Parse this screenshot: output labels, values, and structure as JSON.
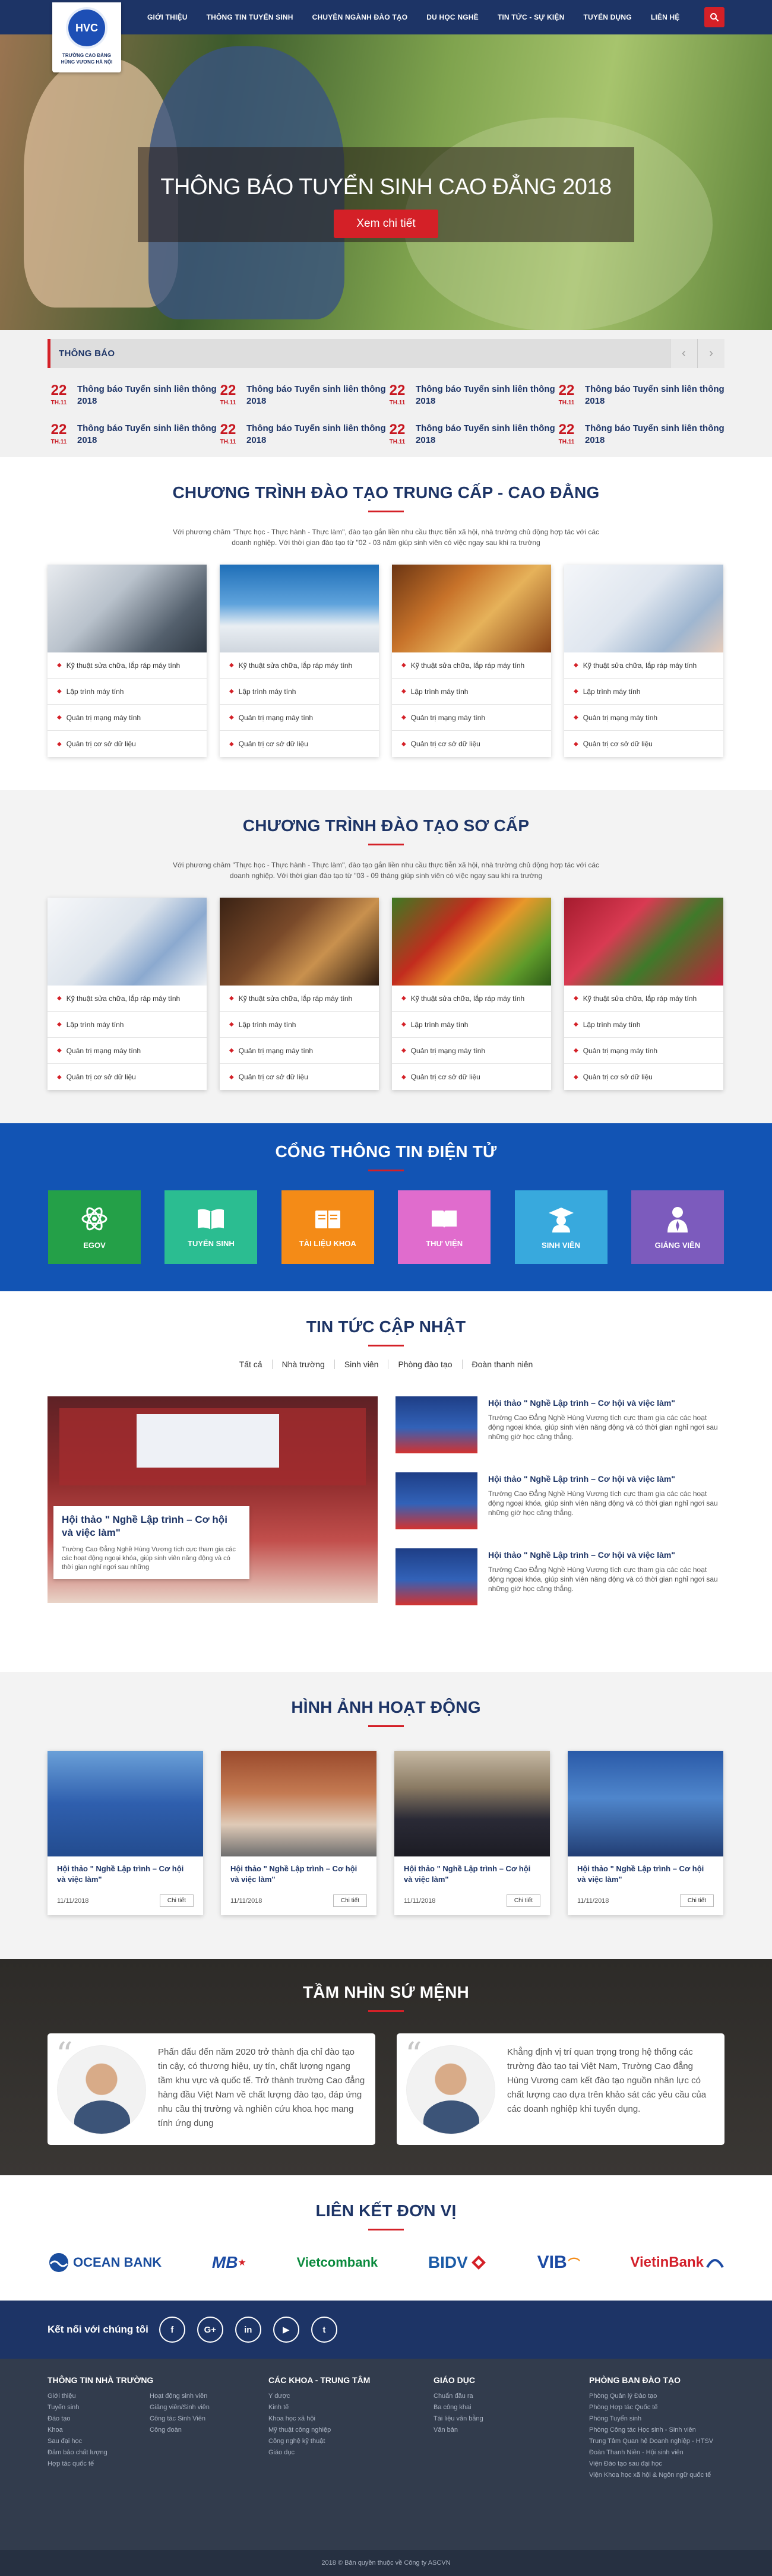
{
  "header": {
    "logo_text": "HVC",
    "logo_caption_1": "TRƯỜNG CAO ĐẲNG",
    "logo_caption_2": "HÙNG VƯƠNG HÀ NỘI",
    "nav": [
      "GIỚI THIỆU",
      "THÔNG TIN TUYỂN SINH",
      "CHUYÊN NGÀNH ĐÀO TẠO",
      "DU HỌC NGHỀ",
      "TIN TỨC - SỰ KIỆN",
      "TUYỂN DỤNG",
      "LIÊN HỆ"
    ]
  },
  "hero": {
    "title": "THÔNG BÁO TUYỂN SINH CAO ĐẲNG 2018",
    "button": "Xem chi tiết"
  },
  "announcements": {
    "title": "THÔNG BÁO",
    "items": [
      {
        "day": "22",
        "month": "TH.11",
        "text": "Thông báo Tuyển sinh liên thông 2018"
      },
      {
        "day": "22",
        "month": "TH.11",
        "text": "Thông báo Tuyển sinh liên thông 2018"
      },
      {
        "day": "22",
        "month": "TH.11",
        "text": "Thông báo Tuyển sinh liên thông 2018"
      },
      {
        "day": "22",
        "month": "TH.11",
        "text": "Thông báo Tuyển sinh liên thông 2018"
      },
      {
        "day": "22",
        "month": "TH.11",
        "text": "Thông báo Tuyển sinh liên thông 2018"
      },
      {
        "day": "22",
        "month": "TH.11",
        "text": "Thông báo Tuyển sinh liên thông 2018"
      },
      {
        "day": "22",
        "month": "TH.11",
        "text": "Thông báo Tuyển sinh liên thông 2018"
      },
      {
        "day": "22",
        "month": "TH.11",
        "text": "Thông báo Tuyển sinh liên thông 2018"
      }
    ]
  },
  "program_mid": {
    "title": "CHƯƠNG TRÌNH ĐÀO TẠO TRUNG CẤP - CAO ĐẲNG",
    "desc": "Với phương châm \"Thực học - Thực hành - Thực làm\", đào tạo gắn liền nhu cầu thực tiễn xã hội, nhà trường chủ động hợp tác với các doanh nghiệp. Với thời gian đào tạo từ \"02 - 03 năm giúp sinh viên có việc ngay sau khi ra trường",
    "items": [
      "Kỹ thuật sửa chữa, lắp ráp máy tính",
      "Lập trình máy tính",
      "Quản trị mạng máy tính",
      "Quản trị cơ sở dữ liệu"
    ]
  },
  "program_basic": {
    "title": "CHƯƠNG TRÌNH ĐÀO TẠO SƠ CẤP",
    "desc": "Với phương châm \"Thực học - Thực hành - Thực làm\", đào tạo gắn liền nhu cầu thực tiễn xã hội, nhà trường chủ động hợp tác với các doanh nghiệp. Với thời gian đào tạo từ \"03 - 09 tháng giúp sinh viên có việc ngay sau khi ra trường",
    "items": [
      "Kỹ thuật sửa chữa, lắp ráp máy tính",
      "Lập trình máy tính",
      "Quản trị mạng máy tính",
      "Quản trị cơ sở dữ liệu"
    ]
  },
  "portal": {
    "title": "CỔNG THÔNG TIN ĐIỆN TỬ",
    "tiles": [
      {
        "label": "EGOV",
        "color": "#24a048"
      },
      {
        "label": "TUYỂN SINH",
        "color": "#2bbd91"
      },
      {
        "label": "TÀI LIỆU KHOA",
        "color": "#f48b17"
      },
      {
        "label": "THƯ VIỆN",
        "color": "#e06ccd"
      },
      {
        "label": "SINH VIÊN",
        "color": "#38a9dd"
      },
      {
        "label": "GIẢNG VIÊN",
        "color": "#7c5bbd"
      }
    ]
  },
  "news": {
    "title": "TIN TỨC CẬP NHẬT",
    "tabs": [
      "Tất cả",
      "Nhà trường",
      "Sinh viên",
      "Phòng đào tạo",
      "Đoàn thanh niên"
    ],
    "main_title": "Hội thảo \" Nghề Lập trình – Cơ hội và việc làm\"",
    "main_desc": "Trường Cao Đẳng Nghề Hùng Vương tích cực tham gia các các hoạt động ngoại khóa, giúp sinh viên năng động và có thời gian nghỉ ngơi sau những",
    "list": [
      {
        "title": "Hội thảo \" Nghề Lập trình – Cơ hội và việc làm\"",
        "desc": "Trường Cao Đẳng Nghề Hùng Vương tích cực tham gia các các hoạt động ngoại khóa, giúp sinh viên năng động và có thời gian nghỉ ngơi sau những giờ học căng thẳng."
      },
      {
        "title": "Hội thảo \" Nghề Lập trình – Cơ hội và việc làm\"",
        "desc": "Trường Cao Đẳng Nghề Hùng Vương tích cực tham gia các các hoạt động ngoại khóa, giúp sinh viên năng động và có thời gian nghỉ ngơi sau những giờ học căng thẳng."
      },
      {
        "title": "Hội thảo \" Nghề Lập trình – Cơ hội và việc làm\"",
        "desc": "Trường Cao Đẳng Nghề Hùng Vương tích cực tham gia các các hoạt động ngoại khóa, giúp sinh viên năng động và có thời gian nghỉ ngơi sau những giờ học căng thẳng."
      }
    ]
  },
  "gallery": {
    "title": "HÌNH ẢNH HOẠT ĐỘNG",
    "items": [
      {
        "title": "Hội thảo \" Nghề Lập trình – Cơ hội và việc làm\"",
        "date": "11/11/2018",
        "button": "Chi tiết"
      },
      {
        "title": "Hội thảo \" Nghề Lập trình – Cơ hội và việc làm\"",
        "date": "11/11/2018",
        "button": "Chi tiết"
      },
      {
        "title": "Hội thảo \" Nghề Lập trình – Cơ hội và việc làm\"",
        "date": "11/11/2018",
        "button": "Chi tiết"
      },
      {
        "title": "Hội thảo \" Nghề Lập trình – Cơ hội và việc làm\"",
        "date": "11/11/2018",
        "button": "Chi tiết"
      }
    ]
  },
  "vision": {
    "title": "TẦM NHÌN SỨ MỆNH",
    "cards": [
      "Phấn đấu đến năm 2020 trở thành địa chỉ đào tạo tin cậy, có thương hiệu, uy tín, chất lượng ngang tầm khu vực và quốc tế. Trở thành trường Cao đẳng hàng đầu Việt Nam về chất lượng đào tạo, đáp ứng nhu cầu thị trường và nghiên cứu khoa học mang tính ứng dụng",
      "Khẳng định vị trí quan trọng trong hệ thống các trường đào tạo tại Việt Nam, Trường Cao đẳng Hùng Vương cam kết đào tạo nguồn nhân lực có chất lượng cao dựa trên khảo sát các yêu cầu của các doanh nghiệp khi tuyển dụng."
    ]
  },
  "partners": {
    "title": "LIÊN KẾT ĐƠN VỊ",
    "logos": [
      {
        "name": "OCEAN BANK",
        "color": "#1a4d9e"
      },
      {
        "name": "MB",
        "color": "#1b4aa3"
      },
      {
        "name": "Vietcombank",
        "color": "#0a8a3d"
      },
      {
        "name": "BIDV",
        "color": "#1b5ba7"
      },
      {
        "name": "VIB",
        "color": "#1b4aa3"
      },
      {
        "name": "VietinBank",
        "color": "#d31f2a"
      }
    ]
  },
  "footer": {
    "social_label": "Kết nối với chúng tôi",
    "social": [
      "f",
      "G+",
      "in",
      "▶",
      "t"
    ],
    "cols": [
      {
        "title": "THÔNG TIN NHÀ TRƯỜNG",
        "items": [
          "Giới thiệu",
          "Tuyển sinh",
          "Đào tạo",
          "Khoa",
          "Sau đại học",
          "Đảm bảo chất lượng",
          "Hợp tác quốc tế"
        ],
        "items2": [
          "Hoạt động sinh viên",
          "Giảng viên/Sinh viên",
          "Công tác Sinh Viên",
          "Công đoàn"
        ]
      },
      {
        "title": "CÁC KHOA - TRUNG TÂM",
        "items": [
          "Y dược",
          "Kinh tế",
          "Khoa học xã hội",
          "Mỹ thuật công nghiệp",
          "Công nghệ kỹ thuật",
          "Giáo dục"
        ]
      },
      {
        "title": "GIÁO DỤC",
        "items": [
          "Chuẩn đầu ra",
          "Ba công khai",
          "Tài liệu văn bằng",
          "Văn bản"
        ]
      },
      {
        "title": "PHÒNG BAN ĐÀO TẠO",
        "items": [
          "Phòng Quản lý Đào tạo",
          "Phòng Hợp tác Quốc tế",
          "Phòng Tuyển sinh",
          "Phòng Công tác Học sinh - Sinh viên",
          "Trung Tâm Quan hệ Doanh nghiệp - HTSV",
          "Đoàn Thanh Niên - Hội sinh viên",
          "Viện Đào tạo sau đại học",
          "Viện Khoa học xã hội & Ngôn ngữ quốc tế"
        ]
      }
    ],
    "copyright": "2018 © Bản quyền thuộc về Công ty ASCVN"
  }
}
